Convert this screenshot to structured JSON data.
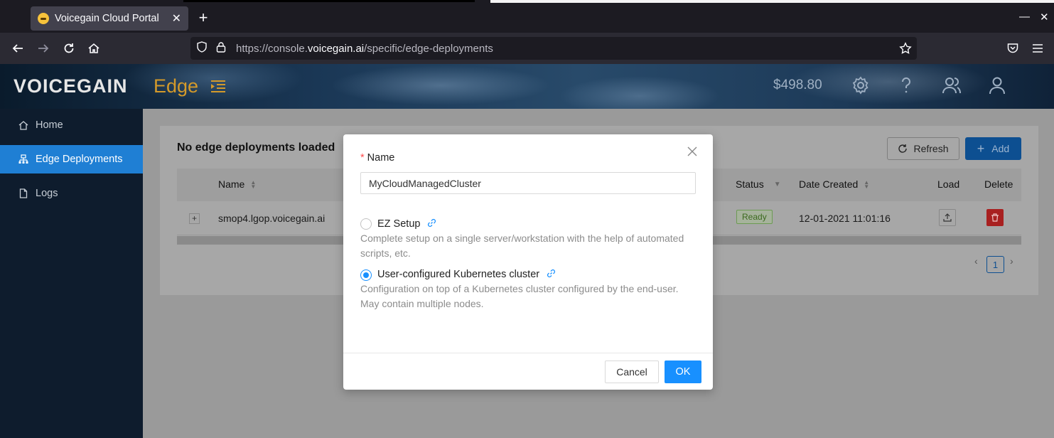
{
  "browser": {
    "tab_title": "Voicegain Cloud Portal",
    "url_prefix": "https://console.",
    "url_host": "voicegain.ai",
    "url_path": "/specific/edge-deployments"
  },
  "header": {
    "logo": "VOICEGAIN",
    "product": "Edge",
    "balance": "$498.80"
  },
  "sidebar": {
    "items": [
      {
        "label": "Home",
        "icon": "home-icon"
      },
      {
        "label": "Edge Deployments",
        "icon": "cluster-icon"
      },
      {
        "label": "Logs",
        "icon": "file-icon"
      }
    ]
  },
  "main": {
    "title": "No edge deployments loaded",
    "refresh_label": "Refresh",
    "add_label": "Add",
    "columns": [
      "Name",
      "Status",
      "Date Created",
      "Load",
      "Delete"
    ],
    "rows": [
      {
        "name": "smop4.lgop.voicegain.ai",
        "status": "Ready",
        "date_created": "12-01-2021 11:01:16"
      }
    ],
    "page": "1"
  },
  "modal": {
    "name_label": "Name",
    "name_value": "MyCloudManagedCluster",
    "options": [
      {
        "title": "EZ Setup",
        "description": "Complete setup on a single server/workstation with the help of automated scripts, etc.",
        "checked": false
      },
      {
        "title": "User-configured Kubernetes cluster",
        "description": "Configuration on top of a Kubernetes cluster configured by the end-user. May contain multiple nodes.",
        "checked": true
      }
    ],
    "cancel_label": "Cancel",
    "ok_label": "OK"
  },
  "colors": {
    "accent": "#1890ff",
    "sidebar_active": "#1f7fd4",
    "danger": "#a82020",
    "status_ready": "#3c6a1f"
  }
}
